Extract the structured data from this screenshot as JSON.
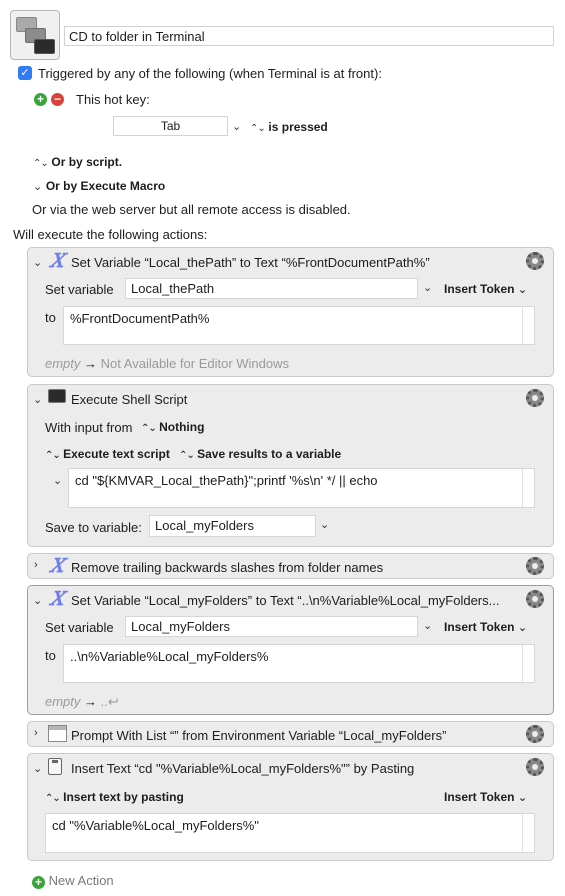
{
  "macro": {
    "name": "CD to folder in Terminal"
  },
  "trigger": {
    "triggered_label": "Triggered by any of the following (when Terminal is at front):",
    "hot_key_label": "This hot key:",
    "hot_key_value": "Tab",
    "hot_key_mode": "is pressed",
    "or_by_script": "Or by script.",
    "or_by_execute_macro": "Or by Execute Macro",
    "web_server_note": "Or via the web server but all remote access is disabled."
  },
  "will_execute_label": "Will execute the following actions:",
  "actions": [
    {
      "title": "Set Variable “Local_thePath” to Text “%FrontDocumentPath%”",
      "set_variable_label": "Set variable",
      "variable": "Local_thePath",
      "insert_token": "Insert Token",
      "to_label": "to",
      "text": "%FrontDocumentPath%",
      "preview_empty": "empty",
      "preview_arrow": "→",
      "preview_value": "Not Available for Editor Windows"
    },
    {
      "title": "Execute Shell Script",
      "input_label": "With input from",
      "input_value": "Nothing",
      "mode": "Execute text script",
      "results": "Save results to a variable",
      "script": "cd \"${KMVAR_Local_thePath}\";printf '%s\\n' */ || echo",
      "save_label": "Save to variable:",
      "save_value": "Local_myFolders"
    },
    {
      "title": "Remove trailing backwards slashes from folder names"
    },
    {
      "title": "Set Variable “Local_myFolders” to Text “..\\n%Variable%Local_myFolders...",
      "set_variable_label": "Set variable",
      "variable": "Local_myFolders",
      "insert_token": "Insert Token",
      "to_label": "to",
      "text": "..\\n%Variable%Local_myFolders%",
      "preview_empty": "empty",
      "preview_arrow": "→",
      "preview_value": "..↩"
    },
    {
      "title": "Prompt With List “” from Environment Variable “Local_myFolders”"
    },
    {
      "title": "Insert Text “cd \"%Variable%Local_myFolders%\"” by Pasting",
      "mode": "Insert text by pasting",
      "insert_token": "Insert Token",
      "text": "cd \"%Variable%Local_myFolders%\""
    }
  ],
  "new_action_label": "New Action",
  "colors": {
    "accent": "#2f7cf6",
    "add_green": "#3aa53a",
    "remove_red": "#d9423a",
    "variable_icon": "#6f7fe8",
    "muted_text": "#9a9a9a"
  },
  "icons": {
    "macro": "terminal-windows-icon",
    "variable": "x-variable-icon",
    "shell": "terminal-icon",
    "prompt": "list-window-icon",
    "insert": "clipboard-icon",
    "gear": "gear-icon"
  }
}
